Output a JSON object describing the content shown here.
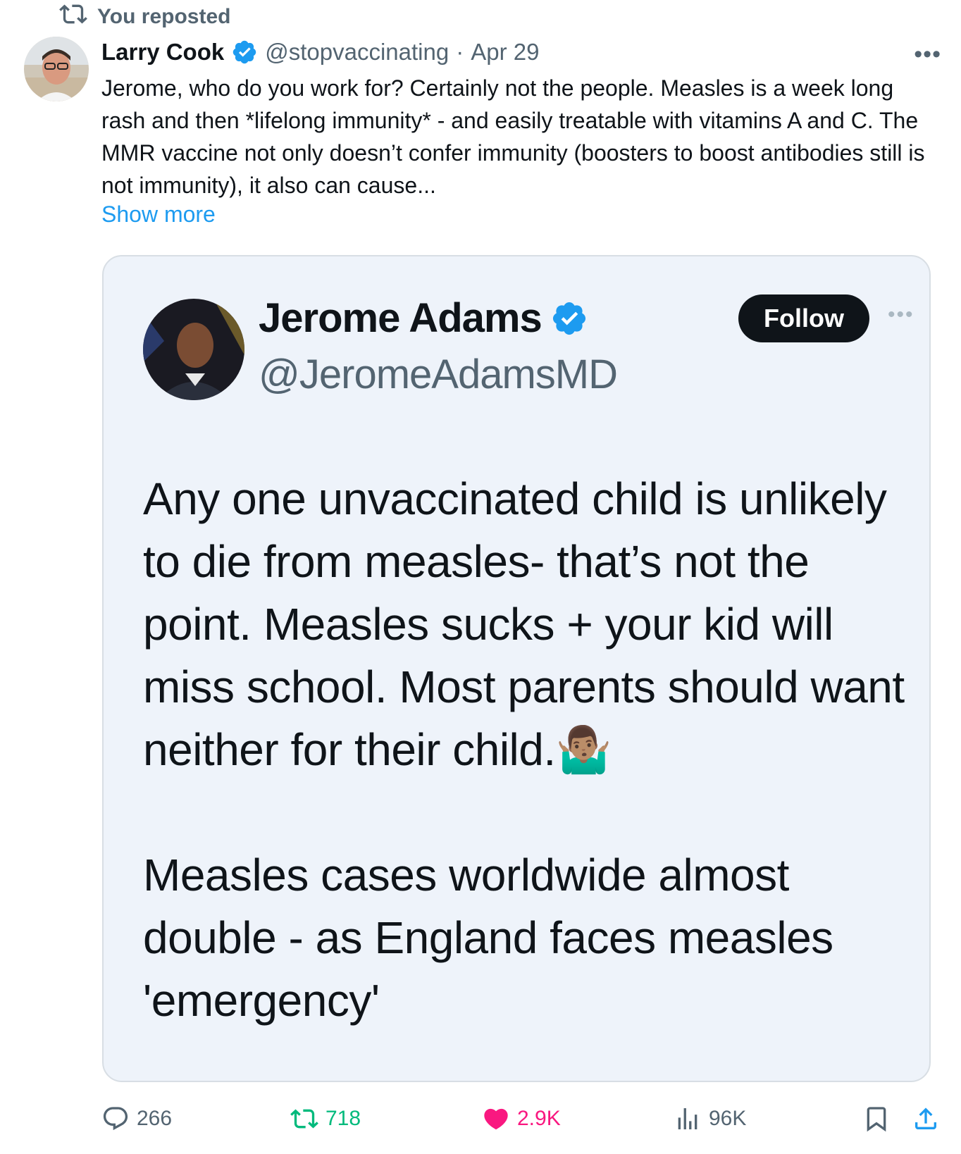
{
  "repost_banner": {
    "icon": "repost-icon",
    "text": "You reposted"
  },
  "tweet": {
    "author_name": "Larry Cook",
    "handle": "@stopvaccinating",
    "separator": "·",
    "date": "Apr 29",
    "more_icon": "•••",
    "text": "Jerome, who do you work for? Certainly not the people. Measles is a week long rash and then *lifelong immunity* - and easily treatable with vitamins A and C. The MMR vaccine not only doesn’t confer immunity (boosters to boost antibodies still is not immunity), it also can cause...",
    "show_more": "Show more"
  },
  "quote": {
    "author_name": "Jerome Adams",
    "handle": "@JeromeAdamsMD",
    "follow_label": "Follow",
    "more_icon": "•••",
    "paragraph1": "Any one unvaccinated child is unlikely to die from measles- that’s not the point. Measles sucks + your kid will miss school. Most parents should want neither for their child.🤷🏽‍♂️",
    "paragraph2": "Measles cases worldwide almost double - as England faces measles 'emergency'"
  },
  "actions": {
    "replies": "266",
    "reposts": "718",
    "likes": "2.9K",
    "views": "96K"
  },
  "colors": {
    "accent": "#1d9bf0",
    "repost_green": "#00ba7c",
    "like_pink": "#f91880",
    "muted": "#536471",
    "quote_bg": "#eef3fa"
  }
}
